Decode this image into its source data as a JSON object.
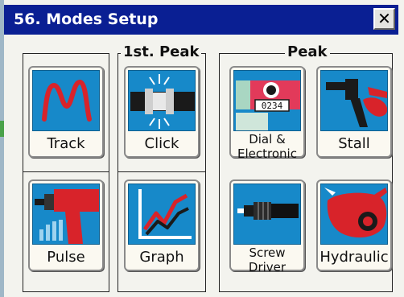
{
  "dialog": {
    "title": "56. Modes Setup",
    "close_label": "✕"
  },
  "groups": {
    "first_peak_label": "1st. Peak",
    "peak_label": "Peak"
  },
  "tiles": {
    "track": {
      "label": "Track",
      "icon": "track-wave-icon"
    },
    "click": {
      "label": "Click",
      "icon": "click-clutch-icon"
    },
    "dial": {
      "label_line1": "Dial &",
      "label_line2": "Electronic",
      "readout": "0234",
      "icon": "dial-wrench-icon"
    },
    "stall": {
      "label": "Stall",
      "icon": "stall-tool-icon"
    },
    "pulse": {
      "label": "Pulse",
      "icon": "pulse-tool-icon"
    },
    "graph": {
      "label": "Graph",
      "icon": "graph-icon"
    },
    "screwdriver": {
      "label_line1": "Screw",
      "label_line2": "Driver",
      "icon": "screwdriver-icon"
    },
    "hydraulic": {
      "label": "Hydraulic",
      "icon": "hydraulic-tool-icon"
    }
  },
  "colors": {
    "titlebar": "#0a1f93",
    "tile_bg": "#1789c9",
    "tool_red": "#d8232a"
  }
}
